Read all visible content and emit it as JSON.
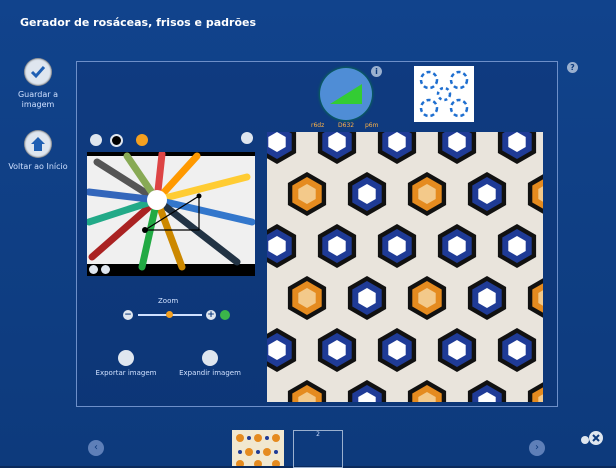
{
  "app": {
    "title": "Gerador de rosáceas, frisos e padrões"
  },
  "sidebar": {
    "save": {
      "label": "Guardar a imagem",
      "icon": "check-icon"
    },
    "home": {
      "label": "Voltar ao Início",
      "icon": "home-icon"
    }
  },
  "triangle": {
    "labels": [
      "r6dz",
      "D632",
      "p6m"
    ]
  },
  "tools": {
    "icons": [
      "swap-icon",
      "black-circle-icon",
      "orange-lock-icon",
      "pencil-icon"
    ]
  },
  "zoom": {
    "label": "Zoom",
    "minus": "−",
    "plus": "+",
    "level": 0.45
  },
  "actions": {
    "export": "Exportar imagem",
    "expand": "Expandir imagem"
  },
  "bottom": {
    "slot_number": "2"
  },
  "colors": {
    "background": "#11438c",
    "accent": "#f4a020",
    "pattern_blue": "#1f3b96",
    "pattern_orange": "#e58b1f"
  }
}
